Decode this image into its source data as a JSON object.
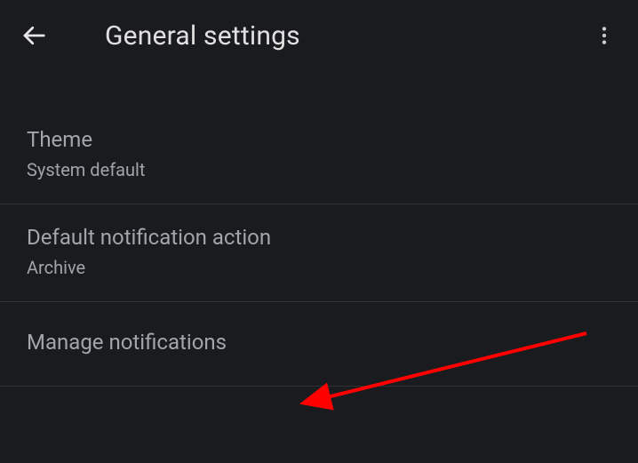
{
  "header": {
    "title": "General settings"
  },
  "settings": {
    "theme": {
      "label": "Theme",
      "value": "System default"
    },
    "defaultNotificationAction": {
      "label": "Default notification action",
      "value": "Archive"
    },
    "manageNotifications": {
      "label": "Manage notifications"
    }
  }
}
